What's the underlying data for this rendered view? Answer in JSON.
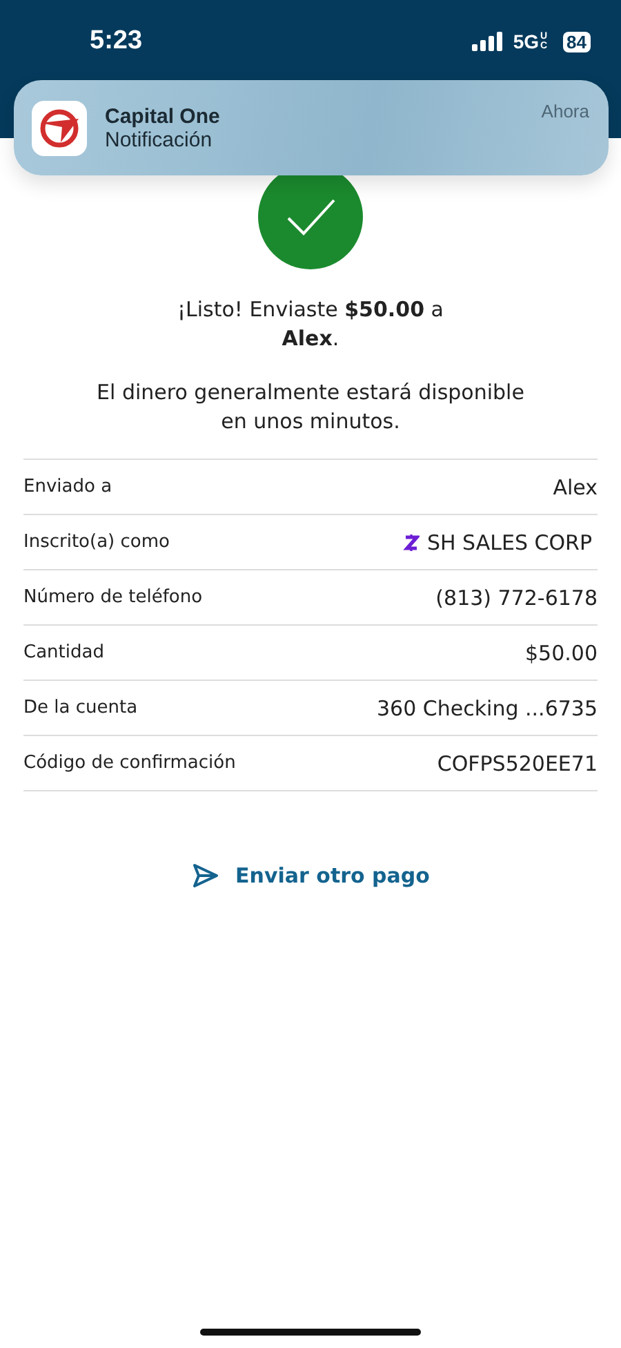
{
  "status_bar": {
    "time": "5:23",
    "network": "5G",
    "network_badge": "UC",
    "battery": "84"
  },
  "notification": {
    "app": "Capital One",
    "body": "Notificación",
    "time": "Ahora"
  },
  "confirmation": {
    "message": "¡Listo! Enviaste **$50.00** a **Alex**.",
    "note": "El dinero generalmente estará disponible en unos minutos."
  },
  "details": [
    {
      "kind": "plain",
      "label": "Enviado a",
      "value": "Alex"
    },
    {
      "kind": "zelle",
      "label": "Inscrito(a) como",
      "value": "SH SALES CORP"
    },
    {
      "kind": "plain",
      "label": "Número de teléfono",
      "value": "(813) 772-6178"
    },
    {
      "kind": "plain",
      "label": "Cantidad",
      "value": "$50.00"
    },
    {
      "kind": "plain",
      "label": "De la cuenta",
      "value": "360 Checking ...6735"
    },
    {
      "kind": "plain",
      "label": "Código de confirmación",
      "value": "COFPS520EE71"
    }
  ],
  "action": {
    "label": "Enviar otro pago"
  }
}
